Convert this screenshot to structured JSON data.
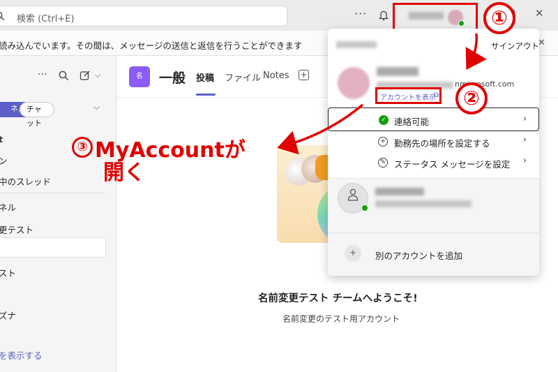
{
  "search": {
    "placeholder": "検索 (Ctrl+E)"
  },
  "banner": {
    "text": "読み込んでいます。その間は、メッセージの送信と返信を行うことができます"
  },
  "left_pane": {
    "pill_channel": "ネル",
    "pill_chat": "チャット",
    "items": [
      "t",
      "ン",
      "中のスレッド",
      "ネル",
      "更テスト",
      "スト",
      "ズナ"
    ],
    "show_more": "を表示する"
  },
  "channel": {
    "badge": "名",
    "title": "一般",
    "tabs": [
      "投稿",
      "ファイル",
      "Notes"
    ]
  },
  "welcome": {
    "title": "名前変更テスト チームへようこそ!",
    "subtitle": "名前変更のテスト用アカウント"
  },
  "popup": {
    "signout": "サインアウト",
    "email_suffix": "nmicrosoft.com",
    "view_account": "アカウントを表示",
    "status": "連絡可能",
    "work_location": "勤務先の場所を設定する",
    "status_message": "ステータス メッセージを設定",
    "add_account": "別のアカウントを追加"
  },
  "annotations": {
    "step1": "①",
    "step2": "②",
    "step3_num": "③",
    "step3_line1": "MyAccountが",
    "step3_line2": "開く"
  },
  "colors": {
    "accent": "#5b5fc7",
    "annotation": "#e00000",
    "available": "#13a10e"
  }
}
